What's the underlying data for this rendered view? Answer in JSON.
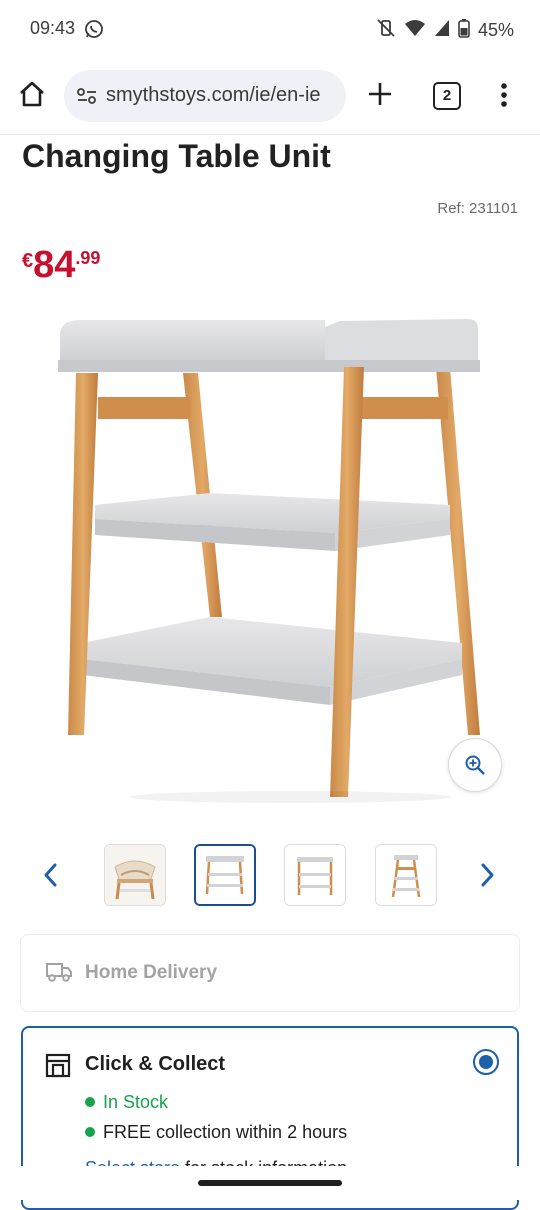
{
  "status_bar": {
    "time": "09:43",
    "battery": "45%"
  },
  "browser": {
    "url": "smythstoys.com/ie/en-ie",
    "tab_count": "2"
  },
  "product": {
    "title": "Changing Table Unit",
    "ref": "Ref: 231101",
    "price_currency": "€",
    "price_main": "84",
    "price_decimal": ".99"
  },
  "gallery": {
    "thumbnail_count": 4,
    "active_index": 1
  },
  "delivery": {
    "home_delivery_label": "Home Delivery",
    "click_collect_label": "Click & Collect",
    "stock_status": "In Stock",
    "free_collection": "FREE collection within 2 hours",
    "select_store_link": "Select store",
    "select_store_suffix": " for stock information"
  },
  "colors": {
    "price_red": "#c8102e",
    "accent_blue": "#1d5fab",
    "stock_green": "#17a34a"
  }
}
